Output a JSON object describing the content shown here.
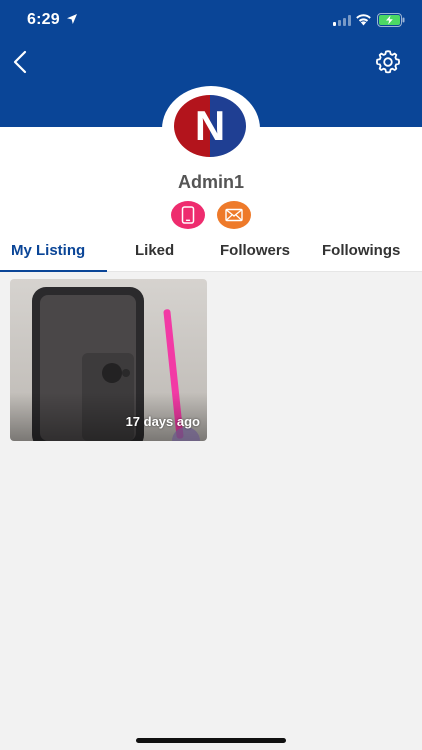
{
  "status_bar": {
    "time": "6:29",
    "icons": [
      "location-arrow-icon",
      "cellular-signal-icon",
      "wifi-icon",
      "battery-charging-icon"
    ]
  },
  "header": {
    "background_color": "#0a4597",
    "back_icon": "chevron-left-icon",
    "settings_icon": "gear-icon"
  },
  "profile": {
    "avatar_letter": "N",
    "avatar_colors": [
      "#b3141c",
      "#1f3f93"
    ],
    "username": "Admin1",
    "contact_icons": [
      {
        "name": "phone-icon",
        "color": "#ee2c6e"
      },
      {
        "name": "mail-icon",
        "color": "#ee7a2a"
      }
    ]
  },
  "tabs": [
    {
      "label": "My Listing",
      "active": true
    },
    {
      "label": "Liked",
      "active": false
    },
    {
      "label": "Followers",
      "active": false
    },
    {
      "label": "Followings",
      "active": false
    }
  ],
  "listings": [
    {
      "time_ago": "17 days ago"
    }
  ],
  "colors": {
    "accent": "#0a4597",
    "background": "#f2f2f2"
  }
}
